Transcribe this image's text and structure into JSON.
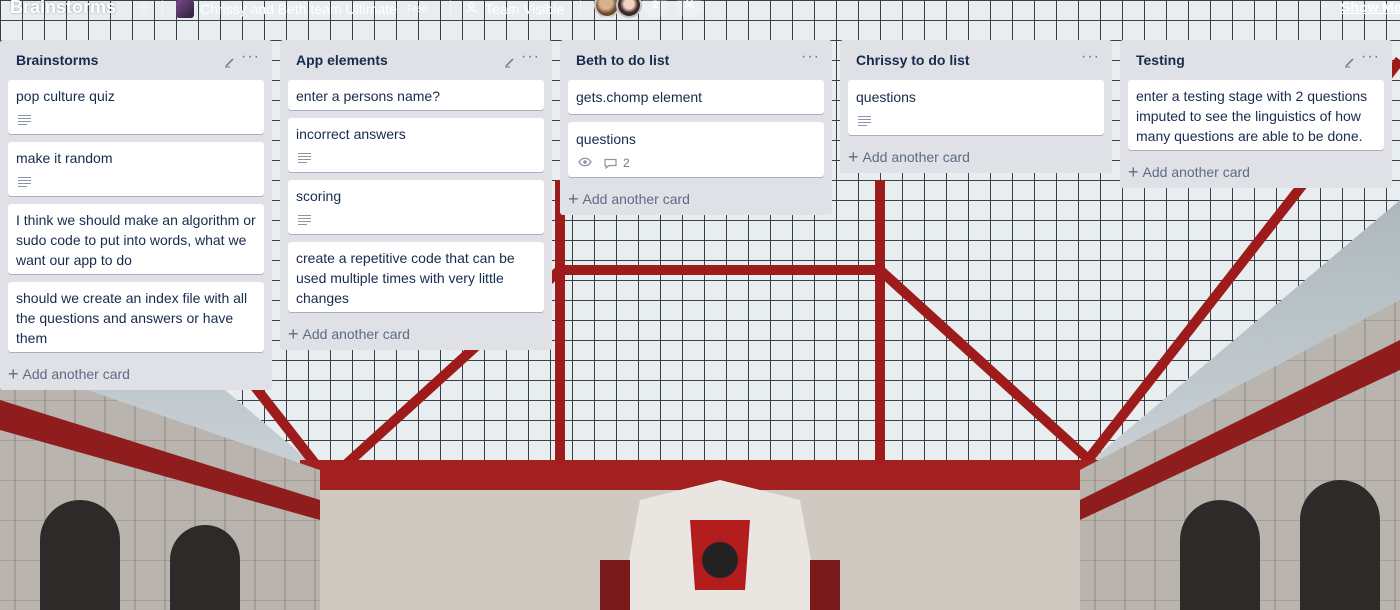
{
  "header": {
    "board_title": "Brainstorms",
    "team_name": "Chrissy and Beth team Ultimate",
    "plan_badge": "Free",
    "visibility": "Team Visible",
    "member_count": "2",
    "show_menu": "Show Me"
  },
  "lists": [
    {
      "title": "Brainstorms",
      "cards": [
        {
          "text": "pop culture quiz",
          "has_description": true
        },
        {
          "text": "make it random",
          "has_description": true
        },
        {
          "text": "I think we should make an algorithm or sudo code to put into words, what we want our app to do"
        },
        {
          "text": "should we create an index file with all the questions and answers or have them"
        }
      ],
      "add_label": "Add another card"
    },
    {
      "title": "App elements",
      "cards": [
        {
          "text": "enter a persons name?"
        },
        {
          "text": "incorrect answers",
          "has_description": true
        },
        {
          "text": "scoring",
          "has_description": true
        },
        {
          "text": "create a repetitive code that can be used multiple times with very little changes"
        }
      ],
      "add_label": "Add another card"
    },
    {
      "title": "Beth to do list",
      "cards": [
        {
          "text": "gets.chomp element"
        },
        {
          "text": "questions",
          "watching": true,
          "comment_count": "2"
        }
      ],
      "add_label": "Add another card"
    },
    {
      "title": "Chrissy to do list",
      "cards": [
        {
          "text": "questions",
          "has_description": true
        }
      ],
      "add_label": "Add another card"
    },
    {
      "title": "Testing",
      "cards": [
        {
          "text": "enter a testing stage with 2 questions imputed to see the linguistics of how many questions are able to be done."
        }
      ],
      "add_label": "Add another card"
    }
  ],
  "icons": {
    "star": "star-icon",
    "team": "team-avatar",
    "visibility": "people-icon",
    "add_member": "add-member-icon",
    "menu": "more-dots-icon",
    "edit": "pencil-icon",
    "description": "description-lines-icon",
    "watch": "eye-icon",
    "comment": "comment-icon",
    "add": "plus-icon"
  },
  "colors": {
    "list_bg": "#dfe1e6",
    "card_bg": "#ffffff",
    "text": "#172b4d",
    "muted": "#5e6c84"
  }
}
